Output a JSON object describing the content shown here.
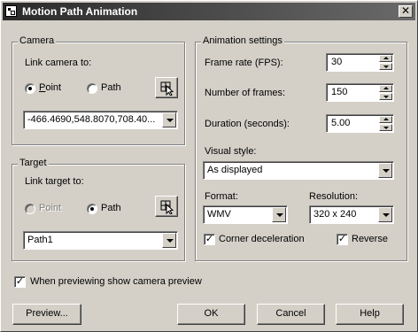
{
  "window": {
    "title": "Motion Path Animation",
    "close_glyph": "✕"
  },
  "camera": {
    "group_label": "Camera",
    "link_label": "Link camera to:",
    "point_label": "Point",
    "path_label": "Path",
    "selected": "Point",
    "combo_value": "-466.4690,548.8070,708.40..."
  },
  "target": {
    "group_label": "Target",
    "link_label": "Link target to:",
    "point_label": "Point",
    "path_label": "Path",
    "selected": "Path",
    "combo_value": "Path1"
  },
  "animation": {
    "group_label": "Animation settings",
    "frame_rate_label": "Frame rate (FPS):",
    "frame_rate_value": "30",
    "frames_label": "Number of frames:",
    "frames_value": "150",
    "duration_label": "Duration (seconds):",
    "duration_value": "5.00",
    "visual_style_label": "Visual style:",
    "visual_style_value": "As displayed",
    "format_label": "Format:",
    "format_value": "WMV",
    "resolution_label": "Resolution:",
    "resolution_value": "320 x 240",
    "corner_decel_label": "Corner deceleration",
    "corner_decel_checked": true,
    "reverse_label": "Reverse",
    "reverse_checked": true
  },
  "preview_camera": {
    "label": "When previewing show camera preview",
    "checked": true
  },
  "buttons": {
    "preview": "Preview...",
    "ok": "OK",
    "cancel": "Cancel",
    "help": "Help"
  },
  "icons": {
    "pick": "pick-point-icon",
    "check": "✓"
  }
}
